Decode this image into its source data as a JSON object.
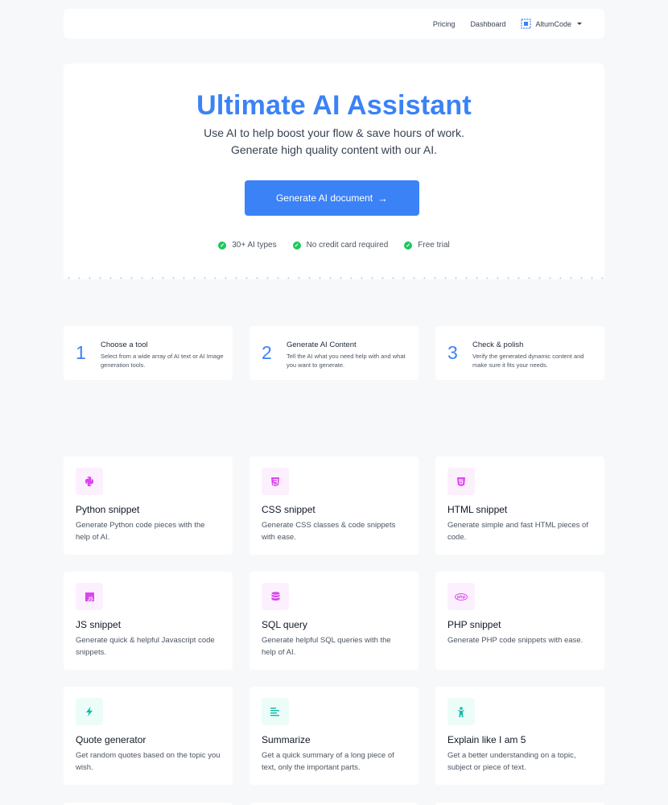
{
  "nav": {
    "links": [
      "Pricing",
      "Dashboard"
    ],
    "account_label": "AltumCode"
  },
  "hero": {
    "title": "Ultimate AI Assistant",
    "subtitle": "Use AI to help boost your flow & save hours of work. Generate high quality content with our AI.",
    "cta_label": "Generate AI document",
    "cta_icon": "arrow-right-icon",
    "features": [
      "30+ AI types",
      "No credit card required",
      "Free trial"
    ]
  },
  "steps": [
    {
      "number": "1",
      "title": "Choose a tool",
      "description": "Select from a wide array of AI text or AI Image generation tools."
    },
    {
      "number": "2",
      "title": "Generate AI Content",
      "description": "Tell the AI what you need help with and what you want to generate."
    },
    {
      "number": "3",
      "title": "Check & polish",
      "description": "Verify the generated dynamic content and make sure it fits your needs."
    }
  ],
  "tools": [
    {
      "title": "Python snippet",
      "description": "Generate Python code pieces with the help of AI.",
      "icon": "python-icon",
      "color": "#d946ef",
      "bg": "#fdf0fe"
    },
    {
      "title": "CSS snippet",
      "description": "Generate CSS classes & code snippets with ease.",
      "icon": "css3-icon",
      "color": "#d946ef",
      "bg": "#fdf0fe"
    },
    {
      "title": "HTML snippet",
      "description": "Generate simple and fast HTML pieces of code.",
      "icon": "html5-icon",
      "color": "#d946ef",
      "bg": "#fdf0fe"
    },
    {
      "title": "JS snippet",
      "description": "Generate quick & helpful Javascript code snippets.",
      "icon": "js-icon",
      "color": "#d946ef",
      "bg": "#fdf0fe"
    },
    {
      "title": "SQL query",
      "description": "Generate helpful SQL queries with the help of AI.",
      "icon": "database-icon",
      "color": "#d946ef",
      "bg": "#fdf0fe"
    },
    {
      "title": "PHP snippet",
      "description": "Generate PHP code snippets with ease.",
      "icon": "php-icon",
      "color": "#d946ef",
      "bg": "#fdf0fe"
    },
    {
      "title": "Quote generator",
      "description": "Get random quotes based on the topic you wish.",
      "icon": "bolt-icon",
      "color": "#14b8a6",
      "bg": "#ecfdf9"
    },
    {
      "title": "Summarize",
      "description": "Get a quick summary of a long piece of text, only the important parts.",
      "icon": "align-left-icon",
      "color": "#14b8a6",
      "bg": "#ecfdf9"
    },
    {
      "title": "Explain like I am 5",
      "description": "Get a better understanding on a topic, subject or piece of text.",
      "icon": "child-icon",
      "color": "#14b8a6",
      "bg": "#ecfdf9"
    }
  ]
}
